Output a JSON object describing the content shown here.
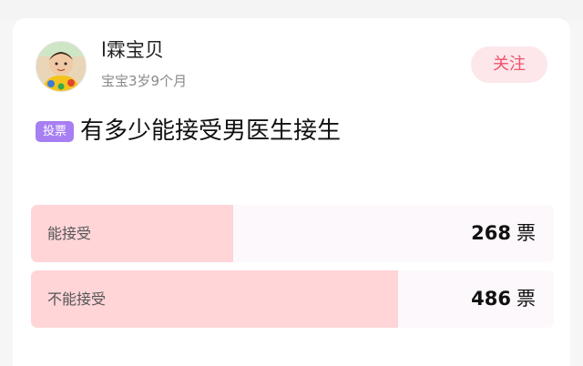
{
  "post": {
    "author": {
      "name": "l霖宝贝",
      "baby_age": "宝宝3岁9个月"
    },
    "follow_label": "关注",
    "tag_label": "投票",
    "question": "有多少能接受男医生接生"
  },
  "poll": {
    "options": [
      {
        "label": "能接受",
        "votes": "268",
        "unit": "票",
        "fill_fraction": 0.387
      },
      {
        "label": "不能接受",
        "votes": "486",
        "unit": "票",
        "fill_fraction": 0.702
      }
    ],
    "colors": {
      "fill": "#ffd5d8",
      "track": "#fdf8fb",
      "follow_text": "#f0516c",
      "tag_bg": "#a77ff2"
    }
  }
}
